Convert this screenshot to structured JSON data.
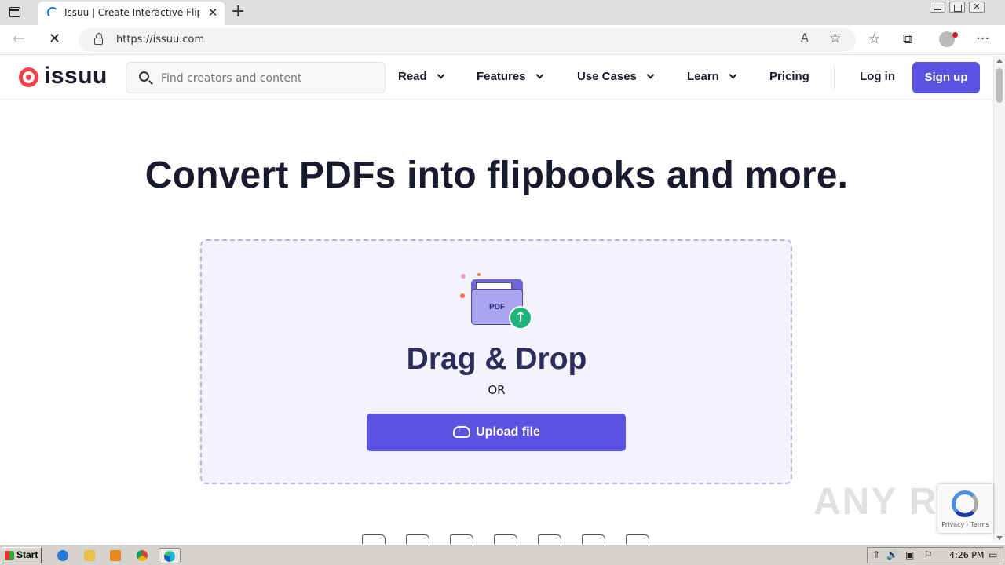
{
  "browser": {
    "tab_title": "Issuu | Create Interactive Flipbook",
    "tab_close": "✕",
    "new_tab": "+",
    "url": "https://issuu.com",
    "back_glyph": "←",
    "stop_glyph": "✕",
    "readaloud_glyph": "A",
    "fav_add_glyph": "☆",
    "favorites_glyph": "☆",
    "collections_glyph": "⧉",
    "more_glyph": "···",
    "close_glyph": "✕"
  },
  "site": {
    "logo_text": "issuu",
    "search_placeholder": "Find creators and content",
    "nav": [
      {
        "label": "Read"
      },
      {
        "label": "Features"
      },
      {
        "label": "Use Cases"
      },
      {
        "label": "Learn"
      },
      {
        "label": "Pricing"
      }
    ],
    "login": "Log in",
    "signup": "Sign up",
    "brand_color": "#5a52e0"
  },
  "main": {
    "title": "Convert PDFs into flipbooks and more.",
    "folder_label": "PDF",
    "arrow_glyph": "↑",
    "drag_drop": "Drag & Drop",
    "or": "OR",
    "upload_label": "Upload file"
  },
  "recaptcha": {
    "text": "Privacy - Terms"
  },
  "watermark": "ANY RUN",
  "taskbar": {
    "start": "Start",
    "clock": "4:26 PM",
    "tray_icons": [
      "⇑",
      "🔊",
      "▣",
      "⚐",
      "▭"
    ]
  }
}
